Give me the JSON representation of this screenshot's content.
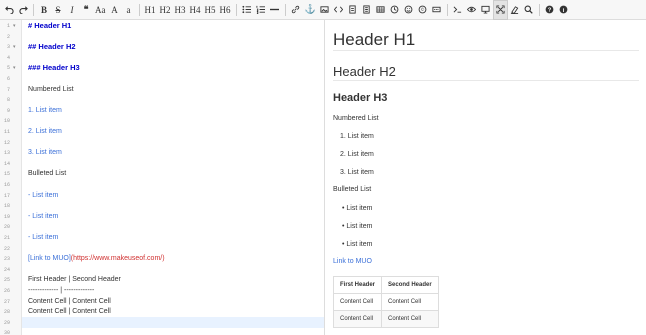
{
  "toolbar": {
    "heading_buttons": [
      "H1",
      "H2",
      "H3",
      "H4",
      "H5",
      "H6"
    ],
    "case_upper": "Aa",
    "case_a": "A",
    "case_lower": "a"
  },
  "editor": {
    "lines": [
      {
        "n": "1",
        "text": "# Header H1",
        "style": "h",
        "fold": "▾"
      },
      {
        "n": "2",
        "text": "",
        "style": "",
        "fold": ""
      },
      {
        "n": "3",
        "text": "## Header H2",
        "style": "h",
        "fold": "▾"
      },
      {
        "n": "4",
        "text": "",
        "style": "",
        "fold": ""
      },
      {
        "n": "5",
        "text": "### Header H3",
        "style": "h",
        "fold": "▾"
      },
      {
        "n": "6",
        "text": "",
        "style": "",
        "fold": ""
      },
      {
        "n": "7",
        "text": "Numbered List",
        "style": "",
        "fold": ""
      },
      {
        "n": "8",
        "text": "",
        "style": "",
        "fold": ""
      },
      {
        "n": "9",
        "text": "1. List item",
        "style": "blue",
        "fold": ""
      },
      {
        "n": "10",
        "text": "",
        "style": "",
        "fold": ""
      },
      {
        "n": "11",
        "text": "2. List item",
        "style": "blue",
        "fold": ""
      },
      {
        "n": "12",
        "text": "",
        "style": "",
        "fold": ""
      },
      {
        "n": "13",
        "text": "3. List item",
        "style": "blue",
        "fold": ""
      },
      {
        "n": "14",
        "text": "",
        "style": "",
        "fold": ""
      },
      {
        "n": "15",
        "text": "Bulleted List",
        "style": "",
        "fold": ""
      },
      {
        "n": "16",
        "text": "",
        "style": "",
        "fold": ""
      },
      {
        "n": "17",
        "text": "- List item",
        "style": "blue",
        "fold": ""
      },
      {
        "n": "18",
        "text": "",
        "style": "",
        "fold": ""
      },
      {
        "n": "19",
        "text": "- List item",
        "style": "blue",
        "fold": ""
      },
      {
        "n": "20",
        "text": "",
        "style": "",
        "fold": ""
      },
      {
        "n": "21",
        "text": "- List item",
        "style": "blue",
        "fold": ""
      },
      {
        "n": "22",
        "text": "",
        "style": "",
        "fold": ""
      },
      {
        "n": "23",
        "text": "",
        "style": "link",
        "fold": ""
      },
      {
        "n": "24",
        "text": "",
        "style": "",
        "fold": ""
      },
      {
        "n": "25",
        "text": "First Header  | Second Header",
        "style": "",
        "fold": ""
      },
      {
        "n": "26",
        "text": "------------- | -------------",
        "style": "",
        "fold": ""
      },
      {
        "n": "27",
        "text": "Content Cell  | Content Cell",
        "style": "",
        "fold": ""
      },
      {
        "n": "28",
        "text": "Content Cell  | Content Cell",
        "style": "",
        "fold": ""
      },
      {
        "n": "29",
        "text": "",
        "style": "",
        "fold": ""
      },
      {
        "n": "30",
        "text": "",
        "style": "",
        "fold": ""
      }
    ],
    "link_text": "[Link to MUO]",
    "link_url": "(https://www.makeuseof.com/)"
  },
  "preview": {
    "h1": "Header H1",
    "h2": "Header H2",
    "h3": "Header H3",
    "numbered_label": "Numbered List",
    "numbered_items": [
      "1.  List item",
      "2.  List item",
      "3.  List item"
    ],
    "bulleted_label": "Bulleted List",
    "bulleted_items": [
      "•  List item",
      "•  List item",
      "•  List item"
    ],
    "link": "Link to MUO",
    "table": {
      "headers": [
        "First Header",
        "Second Header"
      ],
      "rows": [
        [
          "Content Cell",
          "Content Cell"
        ],
        [
          "Content Cell",
          "Content Cell"
        ]
      ]
    }
  }
}
